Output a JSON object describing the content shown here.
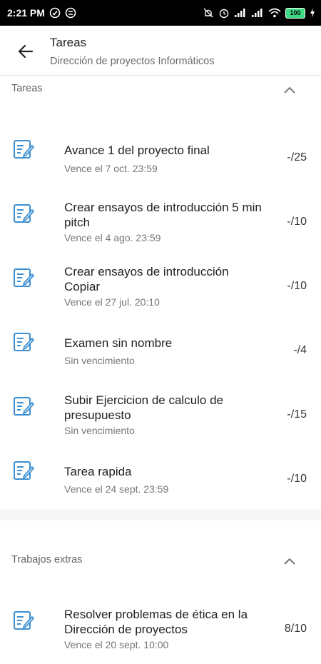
{
  "status_bar": {
    "time": "2:21 PM",
    "battery": "100"
  },
  "header": {
    "title": "Tareas",
    "subtitle": "Dirección de proyectos Informáticos",
    "back_icon": "arrow-left-icon"
  },
  "sections": [
    {
      "title": "Tareas",
      "items": [
        {
          "title": "Avance 1 del proyecto final",
          "due": "Vence el 7 oct. 23:59",
          "points": "-/25"
        },
        {
          "title": "Crear ensayos de introducción 5 min pitch",
          "due": "Vence el 4 ago. 23:59",
          "points": "-/10"
        },
        {
          "title": "Crear ensayos de introducción Copiar",
          "due": "Vence el 27 jul. 20:10",
          "points": "-/10"
        },
        {
          "title": "Examen sin nombre",
          "due": "Sin vencimiento",
          "points": "-/4"
        },
        {
          "title": "Subir Ejercicion de calculo de presupuesto",
          "due": "Sin vencimiento",
          "points": "-/15"
        },
        {
          "title": "Tarea rapida",
          "due": "Vence el 24 sept. 23:59",
          "points": "-/10"
        }
      ]
    },
    {
      "title": "Trabajos extras",
      "items": [
        {
          "title": "Resolver problemas de ética en la Dirección de proyectos",
          "due": "Vence el 20 sept. 10:00",
          "points": "8/10"
        }
      ]
    }
  ],
  "colors": {
    "accent": "#3d8fd1",
    "text_primary": "#222222",
    "text_secondary": "#777777"
  }
}
